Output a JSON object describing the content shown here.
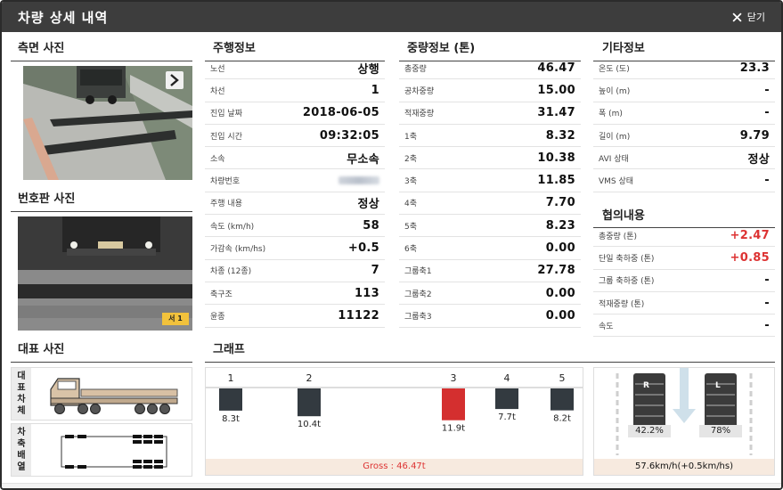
{
  "header": {
    "title": "차량 상세 내역",
    "close_label": "닫기"
  },
  "sections": {
    "side_photo": "측면 사진",
    "plate_photo": "번호판 사진",
    "rep_photo": "대표 사진",
    "driving": "주행정보",
    "weight": "중량정보 (톤)",
    "etc": "기타정보",
    "negotiation": "협의내용",
    "graph": "그래프"
  },
  "driving_info": [
    {
      "label": "노선",
      "value": "상행"
    },
    {
      "label": "차선",
      "value": "1"
    },
    {
      "label": "진입 날짜",
      "value": "2018-06-05"
    },
    {
      "label": "진입 시간",
      "value": "09:32:05"
    },
    {
      "label": "소속",
      "value": "무소속"
    },
    {
      "label": "차량번호",
      "value": ""
    },
    {
      "label": "주행 내용",
      "value": "정상"
    },
    {
      "label": "속도 (km/h)",
      "value": "58"
    },
    {
      "label": "가감속 (km/hs)",
      "value": "+0.5"
    },
    {
      "label": "차종 (12종)",
      "value": "7"
    },
    {
      "label": "축구조",
      "value": "113"
    },
    {
      "label": "윤종",
      "value": "11122"
    }
  ],
  "weight_info": [
    {
      "label": "총중량",
      "value": "46.47"
    },
    {
      "label": "공차중량",
      "value": "15.00"
    },
    {
      "label": "적재중량",
      "value": "31.47"
    },
    {
      "label": "1축",
      "value": "8.32"
    },
    {
      "label": "2축",
      "value": "10.38"
    },
    {
      "label": "3축",
      "value": "11.85"
    },
    {
      "label": "4축",
      "value": "7.70"
    },
    {
      "label": "5축",
      "value": "8.23"
    },
    {
      "label": "6축",
      "value": "0.00"
    },
    {
      "label": "그룹축1",
      "value": "27.78"
    },
    {
      "label": "그룹축2",
      "value": "0.00"
    },
    {
      "label": "그룹축3",
      "value": "0.00"
    }
  ],
  "etc_info": [
    {
      "label": "온도 (도)",
      "value": "23.3"
    },
    {
      "label": "높이 (m)",
      "value": "-"
    },
    {
      "label": "폭 (m)",
      "value": "-"
    },
    {
      "label": "길이 (m)",
      "value": "9.79"
    },
    {
      "label": "AVI 상태",
      "value": "정상"
    },
    {
      "label": "VMS 상태",
      "value": "-"
    }
  ],
  "negotiation_info": [
    {
      "label": "총중량 (톤)",
      "value": "+2.47",
      "red": true
    },
    {
      "label": "단일 축하중 (톤)",
      "value": "+0.85",
      "red": true
    },
    {
      "label": "그룹 축하중 (톤)",
      "value": "-",
      "red": false
    },
    {
      "label": "적재중량 (톤)",
      "value": "-",
      "red": false
    },
    {
      "label": "속도",
      "value": "-",
      "red": false
    }
  ],
  "rep": {
    "vehicle_label": [
      "대",
      "표",
      "차",
      "체"
    ],
    "axle_label": [
      "차",
      "축",
      "배",
      "열"
    ]
  },
  "plate_tag": "서 1",
  "chart_data": {
    "type": "bar",
    "categories": [
      "1",
      "2",
      "3",
      "4",
      "5"
    ],
    "values": [
      8.3,
      10.4,
      11.9,
      7.7,
      8.2
    ],
    "value_labels": [
      "8.3t",
      "10.4t",
      "11.9t",
      "7.7t",
      "8.2t"
    ],
    "highlight_index": 2,
    "colors": {
      "normal": "#333a40",
      "highlight": "#d42f2f"
    },
    "footer": "Gross : 46.47t"
  },
  "tire": {
    "left_label": "R",
    "right_label": "L",
    "left_pct": "42.2%",
    "right_pct": "78%",
    "speed": "57.6km/h(+0.5km/hs)"
  }
}
